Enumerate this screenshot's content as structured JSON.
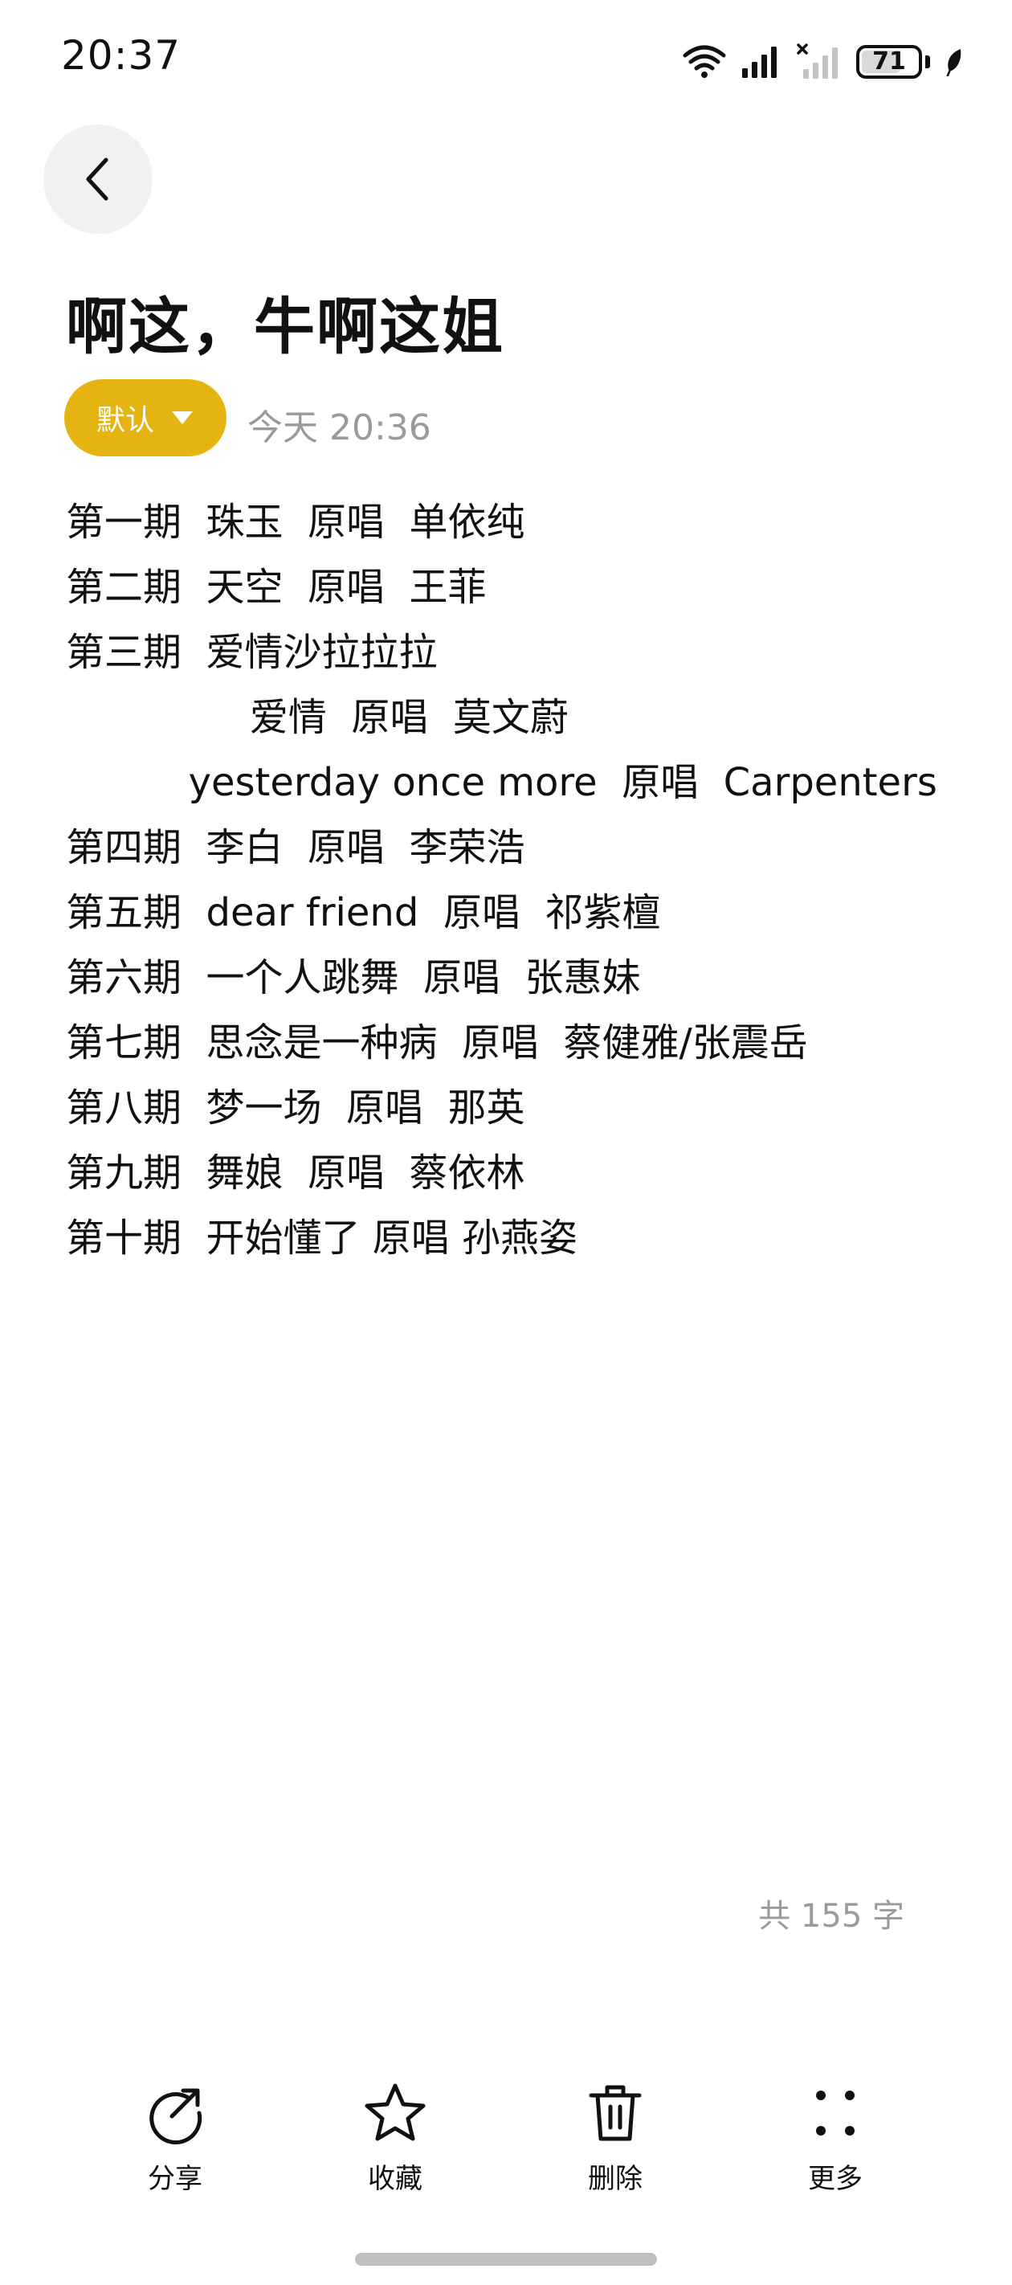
{
  "status_bar": {
    "time": "20:37",
    "battery_level": 71,
    "battery_label": "71",
    "icons": [
      "wifi-icon",
      "signal-icon",
      "signal-no-service-icon",
      "battery-icon",
      "eco-leaf-icon"
    ]
  },
  "header": {
    "back_icon": "chevron-left-icon"
  },
  "note": {
    "title": "啊这，牛啊这姐",
    "category_label": "默认",
    "time": "今天 20:36",
    "lines": [
      "第一期  珠玉  原唱  单依纯",
      "第二期  天空  原唱  王菲",
      "第三期  爱情沙拉拉拉",
      "               爱情  原唱  莫文蔚",
      "          yesterday once more  原唱  Carpenters",
      "第四期  李白  原唱  李荣浩",
      "第五期  dear friend  原唱  祁紫檀",
      "第六期  一个人跳舞  原唱  张惠妹",
      "第七期  思念是一种病  原唱  蔡健雅/张震岳",
      "第八期  梦一场  原唱  那英",
      "第九期  舞娘  原唱  蔡依林",
      "第十期  开始懂了 原唱 孙燕姿"
    ],
    "word_count": "共 155 字"
  },
  "toolbar": {
    "share_label": "分享",
    "favorite_label": "收藏",
    "delete_label": "删除",
    "more_label": "更多"
  },
  "colors": {
    "accent": "#e6b410",
    "text": "#111111",
    "muted": "#9a9a9a",
    "back_bg": "#f1f1f1"
  }
}
